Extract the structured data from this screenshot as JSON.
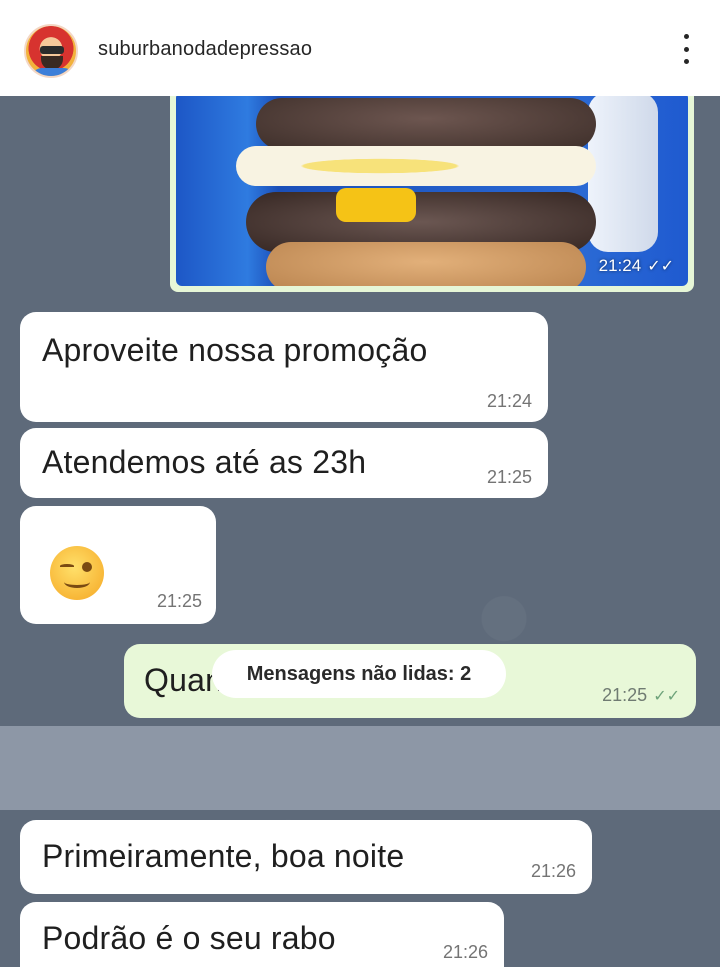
{
  "post": {
    "username": "suburbanodadepressao"
  },
  "chat": {
    "image_message": {
      "time": "21:24",
      "status": "read"
    },
    "messages": [
      {
        "direction": "in",
        "text": "Aproveite nossa promoção",
        "time": "21:24"
      },
      {
        "direction": "in",
        "text": "Atendemos até as 23h",
        "time": "21:25"
      },
      {
        "direction": "in",
        "emoji": "winking-face",
        "time": "21:25"
      },
      {
        "direction": "out",
        "text": "Quanto tá esse podrão?",
        "time": "21:25",
        "status": "read"
      },
      {
        "direction": "in",
        "text": "Primeiramente, boa noite",
        "time": "21:26"
      },
      {
        "direction": "in",
        "text": "Podrão é o seu rabo",
        "time": "21:26"
      }
    ],
    "unread_banner": "Mensagens não lidas: 2"
  },
  "icons": {
    "more": "more-vertical-icon",
    "check": "double-check-icon"
  },
  "colors": {
    "chat_background": "#5e6a7a",
    "incoming_bubble": "#ffffff",
    "outgoing_bubble": "#e8f8d8"
  }
}
